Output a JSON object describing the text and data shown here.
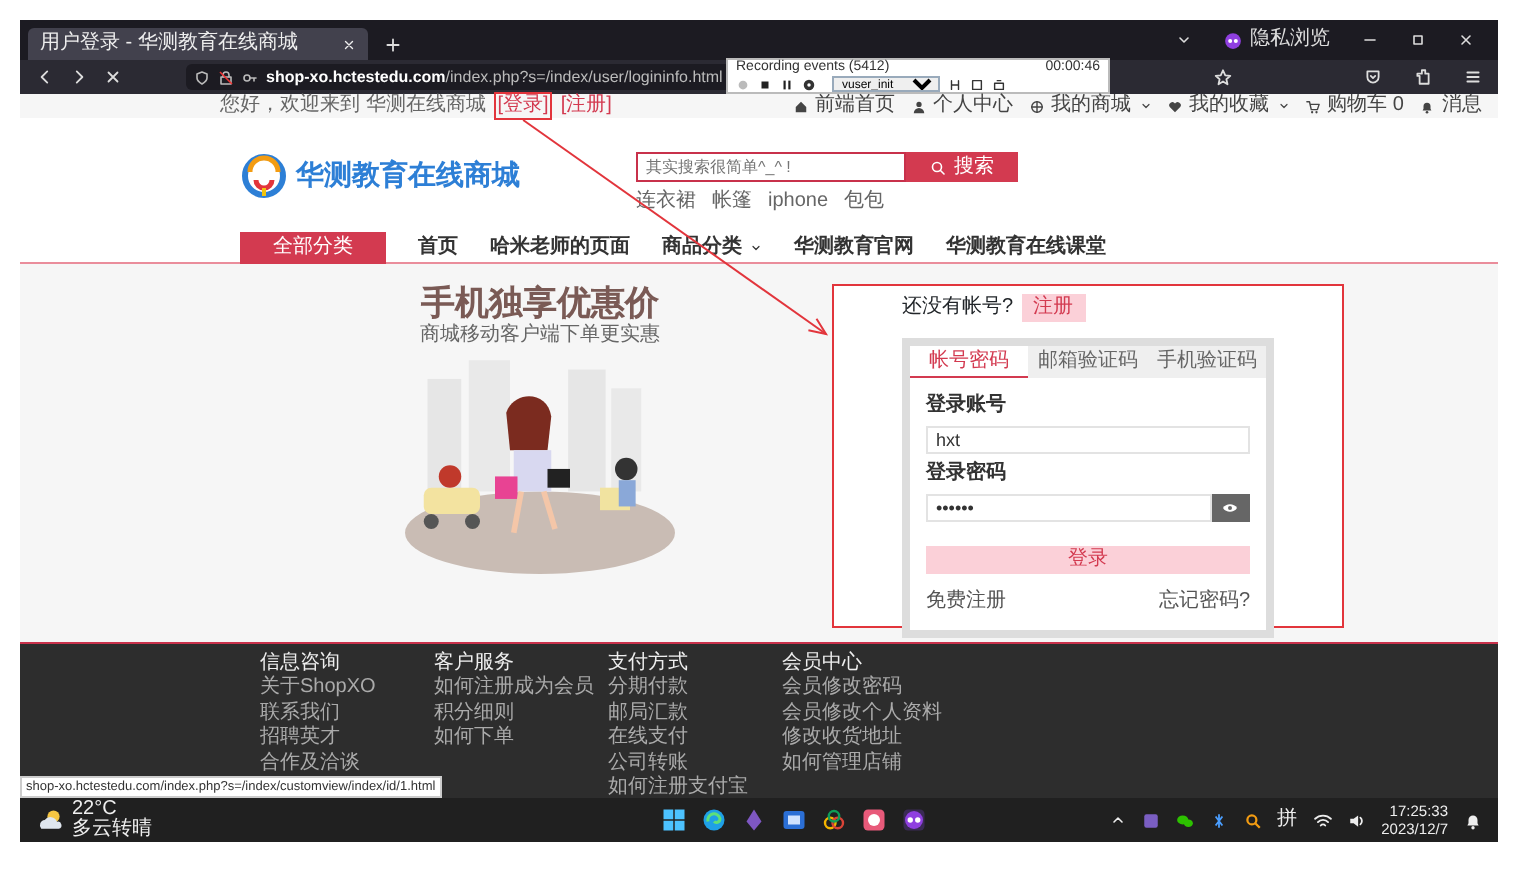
{
  "browser": {
    "tab_title": "用户登录 - 华测教育在线商城",
    "url_host": "shop-xo.hctestedu.com",
    "url_path": "/index.php?s=/index/user/logininfo.html",
    "profile_label": "隐私浏览"
  },
  "recorder": {
    "title": "Recording events  (5412)",
    "timer": "00:00:46",
    "script": "vuser_init"
  },
  "top_bar": {
    "greeting": "您好，欢迎来到 华测在线商城",
    "login_link": "[登录]",
    "register_link": "[注册]"
  },
  "top_links": [
    {
      "kind": "home",
      "label": "前端首页",
      "has_dropdown": false
    },
    {
      "kind": "user",
      "label": "个人中心",
      "has_dropdown": false
    },
    {
      "kind": "globe",
      "label": "我的商城",
      "has_dropdown": true
    },
    {
      "kind": "heart",
      "label": "我的收藏",
      "has_dropdown": true
    },
    {
      "kind": "cart",
      "label": "购物车 0",
      "has_dropdown": false
    },
    {
      "kind": "bell",
      "label": "消息",
      "has_dropdown": false
    }
  ],
  "logo_text": "华测教育在线商城",
  "search": {
    "placeholder": "其实搜索很简单^_^ !",
    "button": "搜索"
  },
  "hot_words": [
    "连衣裙",
    "帐篷",
    "iphone",
    "包包"
  ],
  "category_button": "全部分类",
  "nav": [
    {
      "label": "首页",
      "has_dropdown": false
    },
    {
      "label": "哈米老师的页面",
      "has_dropdown": false
    },
    {
      "label": "商品分类",
      "has_dropdown": true
    },
    {
      "label": "华测教育官网",
      "has_dropdown": false
    },
    {
      "label": "华测教育在线课堂",
      "has_dropdown": false
    }
  ],
  "promo": {
    "title": "手机独享优惠价",
    "subtitle": "商城移动客户端下单更实惠"
  },
  "login": {
    "prompt": "还没有帐号?",
    "register_button": "注册",
    "tabs": [
      {
        "label": "帐号密码",
        "selected": true
      },
      {
        "label": "邮箱验证码",
        "selected": false
      },
      {
        "label": "手机验证码",
        "selected": false
      }
    ],
    "account_label": "登录账号",
    "account_value": "hxt",
    "password_label": "登录密码",
    "password_value": "••••••",
    "submit": "登录",
    "free_register": "免费注册",
    "forgot_password": "忘记密码?"
  },
  "footer": [
    {
      "heading": "信息咨询",
      "links": [
        "关于ShopXO",
        "联系我们",
        "招聘英才",
        "合作及洽谈"
      ]
    },
    {
      "heading": "客户服务",
      "links": [
        "如何注册成为会员",
        "积分细则",
        "如何下单"
      ]
    },
    {
      "heading": "支付方式",
      "links": [
        "分期付款",
        "邮局汇款",
        "在线支付",
        "公司转账",
        "如何注册支付宝"
      ]
    },
    {
      "heading": "会员中心",
      "links": [
        "会员修改密码",
        "会员修改个人资料",
        "修改收货地址",
        "如何管理店铺"
      ]
    }
  ],
  "status_url": "shop-xo.hctestedu.com/index.php?s=/index/customview/index/id/1.html",
  "taskbar": {
    "temperature": "22°C",
    "weather": "多云转晴",
    "ime": "拼",
    "time": "17:25:33",
    "date": "2023/12/7"
  }
}
